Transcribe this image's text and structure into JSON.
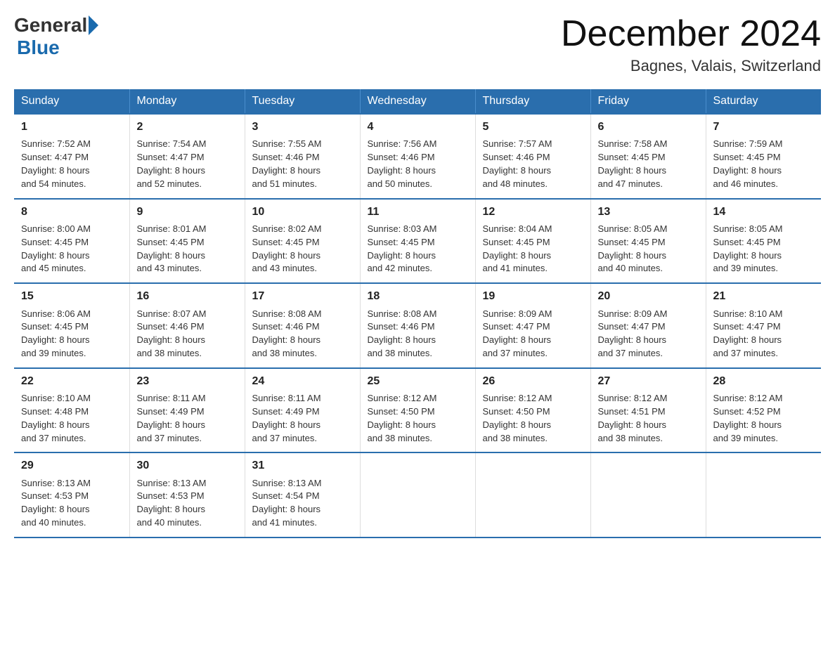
{
  "logo": {
    "general": "General",
    "blue": "Blue"
  },
  "title": {
    "month": "December 2024",
    "location": "Bagnes, Valais, Switzerland"
  },
  "headers": [
    "Sunday",
    "Monday",
    "Tuesday",
    "Wednesday",
    "Thursday",
    "Friday",
    "Saturday"
  ],
  "weeks": [
    [
      {
        "day": "1",
        "info": "Sunrise: 7:52 AM\nSunset: 4:47 PM\nDaylight: 8 hours\nand 54 minutes."
      },
      {
        "day": "2",
        "info": "Sunrise: 7:54 AM\nSunset: 4:47 PM\nDaylight: 8 hours\nand 52 minutes."
      },
      {
        "day": "3",
        "info": "Sunrise: 7:55 AM\nSunset: 4:46 PM\nDaylight: 8 hours\nand 51 minutes."
      },
      {
        "day": "4",
        "info": "Sunrise: 7:56 AM\nSunset: 4:46 PM\nDaylight: 8 hours\nand 50 minutes."
      },
      {
        "day": "5",
        "info": "Sunrise: 7:57 AM\nSunset: 4:46 PM\nDaylight: 8 hours\nand 48 minutes."
      },
      {
        "day": "6",
        "info": "Sunrise: 7:58 AM\nSunset: 4:45 PM\nDaylight: 8 hours\nand 47 minutes."
      },
      {
        "day": "7",
        "info": "Sunrise: 7:59 AM\nSunset: 4:45 PM\nDaylight: 8 hours\nand 46 minutes."
      }
    ],
    [
      {
        "day": "8",
        "info": "Sunrise: 8:00 AM\nSunset: 4:45 PM\nDaylight: 8 hours\nand 45 minutes."
      },
      {
        "day": "9",
        "info": "Sunrise: 8:01 AM\nSunset: 4:45 PM\nDaylight: 8 hours\nand 43 minutes."
      },
      {
        "day": "10",
        "info": "Sunrise: 8:02 AM\nSunset: 4:45 PM\nDaylight: 8 hours\nand 43 minutes."
      },
      {
        "day": "11",
        "info": "Sunrise: 8:03 AM\nSunset: 4:45 PM\nDaylight: 8 hours\nand 42 minutes."
      },
      {
        "day": "12",
        "info": "Sunrise: 8:04 AM\nSunset: 4:45 PM\nDaylight: 8 hours\nand 41 minutes."
      },
      {
        "day": "13",
        "info": "Sunrise: 8:05 AM\nSunset: 4:45 PM\nDaylight: 8 hours\nand 40 minutes."
      },
      {
        "day": "14",
        "info": "Sunrise: 8:05 AM\nSunset: 4:45 PM\nDaylight: 8 hours\nand 39 minutes."
      }
    ],
    [
      {
        "day": "15",
        "info": "Sunrise: 8:06 AM\nSunset: 4:45 PM\nDaylight: 8 hours\nand 39 minutes."
      },
      {
        "day": "16",
        "info": "Sunrise: 8:07 AM\nSunset: 4:46 PM\nDaylight: 8 hours\nand 38 minutes."
      },
      {
        "day": "17",
        "info": "Sunrise: 8:08 AM\nSunset: 4:46 PM\nDaylight: 8 hours\nand 38 minutes."
      },
      {
        "day": "18",
        "info": "Sunrise: 8:08 AM\nSunset: 4:46 PM\nDaylight: 8 hours\nand 38 minutes."
      },
      {
        "day": "19",
        "info": "Sunrise: 8:09 AM\nSunset: 4:47 PM\nDaylight: 8 hours\nand 37 minutes."
      },
      {
        "day": "20",
        "info": "Sunrise: 8:09 AM\nSunset: 4:47 PM\nDaylight: 8 hours\nand 37 minutes."
      },
      {
        "day": "21",
        "info": "Sunrise: 8:10 AM\nSunset: 4:47 PM\nDaylight: 8 hours\nand 37 minutes."
      }
    ],
    [
      {
        "day": "22",
        "info": "Sunrise: 8:10 AM\nSunset: 4:48 PM\nDaylight: 8 hours\nand 37 minutes."
      },
      {
        "day": "23",
        "info": "Sunrise: 8:11 AM\nSunset: 4:49 PM\nDaylight: 8 hours\nand 37 minutes."
      },
      {
        "day": "24",
        "info": "Sunrise: 8:11 AM\nSunset: 4:49 PM\nDaylight: 8 hours\nand 37 minutes."
      },
      {
        "day": "25",
        "info": "Sunrise: 8:12 AM\nSunset: 4:50 PM\nDaylight: 8 hours\nand 38 minutes."
      },
      {
        "day": "26",
        "info": "Sunrise: 8:12 AM\nSunset: 4:50 PM\nDaylight: 8 hours\nand 38 minutes."
      },
      {
        "day": "27",
        "info": "Sunrise: 8:12 AM\nSunset: 4:51 PM\nDaylight: 8 hours\nand 38 minutes."
      },
      {
        "day": "28",
        "info": "Sunrise: 8:12 AM\nSunset: 4:52 PM\nDaylight: 8 hours\nand 39 minutes."
      }
    ],
    [
      {
        "day": "29",
        "info": "Sunrise: 8:13 AM\nSunset: 4:53 PM\nDaylight: 8 hours\nand 40 minutes."
      },
      {
        "day": "30",
        "info": "Sunrise: 8:13 AM\nSunset: 4:53 PM\nDaylight: 8 hours\nand 40 minutes."
      },
      {
        "day": "31",
        "info": "Sunrise: 8:13 AM\nSunset: 4:54 PM\nDaylight: 8 hours\nand 41 minutes."
      },
      {
        "day": "",
        "info": ""
      },
      {
        "day": "",
        "info": ""
      },
      {
        "day": "",
        "info": ""
      },
      {
        "day": "",
        "info": ""
      }
    ]
  ]
}
